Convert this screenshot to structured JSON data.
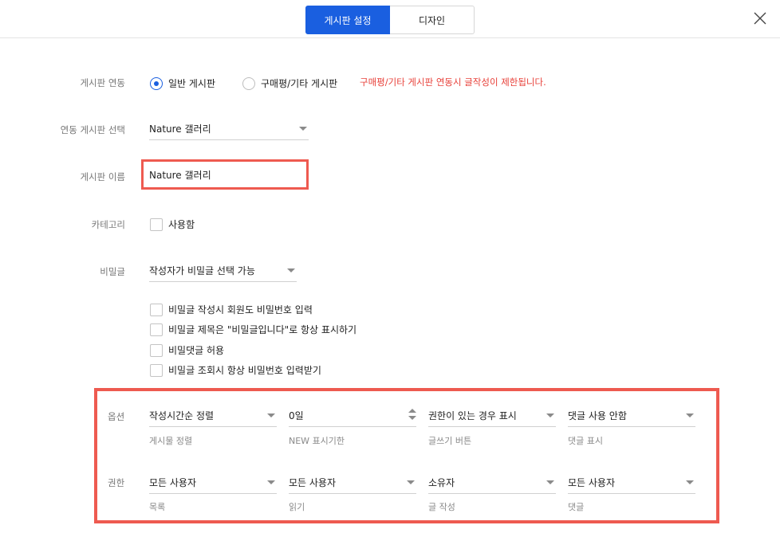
{
  "header": {
    "tabs": [
      {
        "label": "게시판 설정",
        "active": true
      },
      {
        "label": "디자인",
        "active": false
      }
    ],
    "close_icon": "close-x-icon"
  },
  "board_link": {
    "label": "게시판 연동",
    "options": [
      {
        "label": "일반 게시판",
        "selected": true
      },
      {
        "label": "구매평/기타 게시판",
        "selected": false
      }
    ],
    "warning": "구매평/기타 게시판 연동시 글작성이 제한됩니다."
  },
  "link_select": {
    "label": "연동 게시판 선택",
    "value": "Nature 갤러리"
  },
  "board_name": {
    "label": "게시판 이름",
    "value": "Nature 갤러리"
  },
  "category": {
    "label": "카테고리",
    "checkbox_label": "사용함",
    "checked": false
  },
  "secret": {
    "label": "비밀글",
    "select_value": "작성자가 비밀글 선택 가능",
    "checkboxes": [
      {
        "label": "비밀글 작성시 회원도 비밀번호 입력",
        "checked": false
      },
      {
        "label": "비밀글 제목은 \"비밀글입니다\"로 항상 표시하기",
        "checked": false
      },
      {
        "label": "비밀댓글 허용",
        "checked": false
      },
      {
        "label": "비밀글 조회시 항상 비밀번호 입력받기",
        "checked": false
      }
    ]
  },
  "options": {
    "label": "옵션",
    "fields": [
      {
        "value": "작성시간순 정렬",
        "caption": "게시물 정렬"
      },
      {
        "value": "0일",
        "caption": "NEW 표시기한"
      },
      {
        "value": "권한이 있는 경우 표시",
        "caption": "글쓰기 버튼"
      },
      {
        "value": "댓글 사용 안함",
        "caption": "댓글 표시"
      }
    ]
  },
  "permissions": {
    "label": "권한",
    "fields": [
      {
        "value": "모든 사용자",
        "caption": "목록"
      },
      {
        "value": "모든 사용자",
        "caption": "읽기"
      },
      {
        "value": "소유자",
        "caption": "글 작성"
      },
      {
        "value": "모든 사용자",
        "caption": "댓글"
      }
    ]
  },
  "colors": {
    "accent": "#1a5fe0",
    "warning": "#e8413a",
    "highlight_border": "#ee5a50"
  }
}
